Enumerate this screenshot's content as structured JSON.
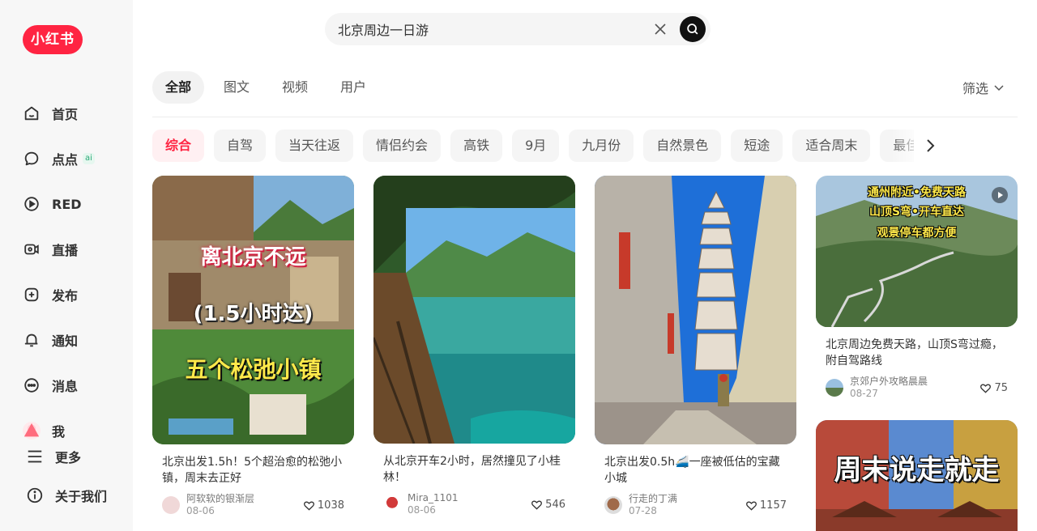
{
  "sidebar": {
    "logo": "小红书",
    "items": [
      {
        "label": "首页"
      },
      {
        "label": "点点",
        "badge": "ai"
      },
      {
        "label": "RED"
      },
      {
        "label": "直播"
      },
      {
        "label": "发布"
      },
      {
        "label": "通知"
      },
      {
        "label": "消息"
      },
      {
        "label": "我"
      },
      {
        "label": "更多"
      },
      {
        "label": "关于我们"
      }
    ]
  },
  "search": {
    "value": "北京周边一日游"
  },
  "tabs": [
    {
      "label": "全部",
      "active": true
    },
    {
      "label": "图文"
    },
    {
      "label": "视频"
    },
    {
      "label": "用户"
    }
  ],
  "filter_label": "筛选",
  "chips": [
    "综合",
    "自驾",
    "当天往返",
    "情侣约会",
    "高铁",
    "9月",
    "九月份",
    "自然景色",
    "短途",
    "适合周末",
    "最佳"
  ],
  "cards": [
    {
      "title": "北京出发1.5h！5个超治愈的松弛小镇，周末去正好",
      "author": "阿软软的银渐层",
      "date": "08-06",
      "likes": "1038",
      "overlay": [
        "离北京不远",
        "(1.5小时达)",
        "五个松弛小镇"
      ]
    },
    {
      "title": "从北京开车2小时，居然撞见了小桂林！",
      "author": "Mira_1101",
      "date": "08-06",
      "likes": "546"
    },
    {
      "title": "北京出发0.5h🚄一座被低估的宝藏小城",
      "author": "行走的丁满",
      "date": "07-28",
      "likes": "1157"
    },
    {
      "title": "北京周边免费天路，山顶S弯过瘾，附自驾路线",
      "author": "京郊户外攻略晨晨",
      "date": "08-27",
      "likes": "75",
      "overlay": [
        "通州附近•免费天路",
        "山顶S弯•开车直达",
        "观景停车都方便"
      ]
    },
    {
      "overlay": [
        "周末说走就走"
      ]
    }
  ],
  "colors": {
    "brand": "#ff2442",
    "chip_active_bg": "#fff0f2"
  }
}
